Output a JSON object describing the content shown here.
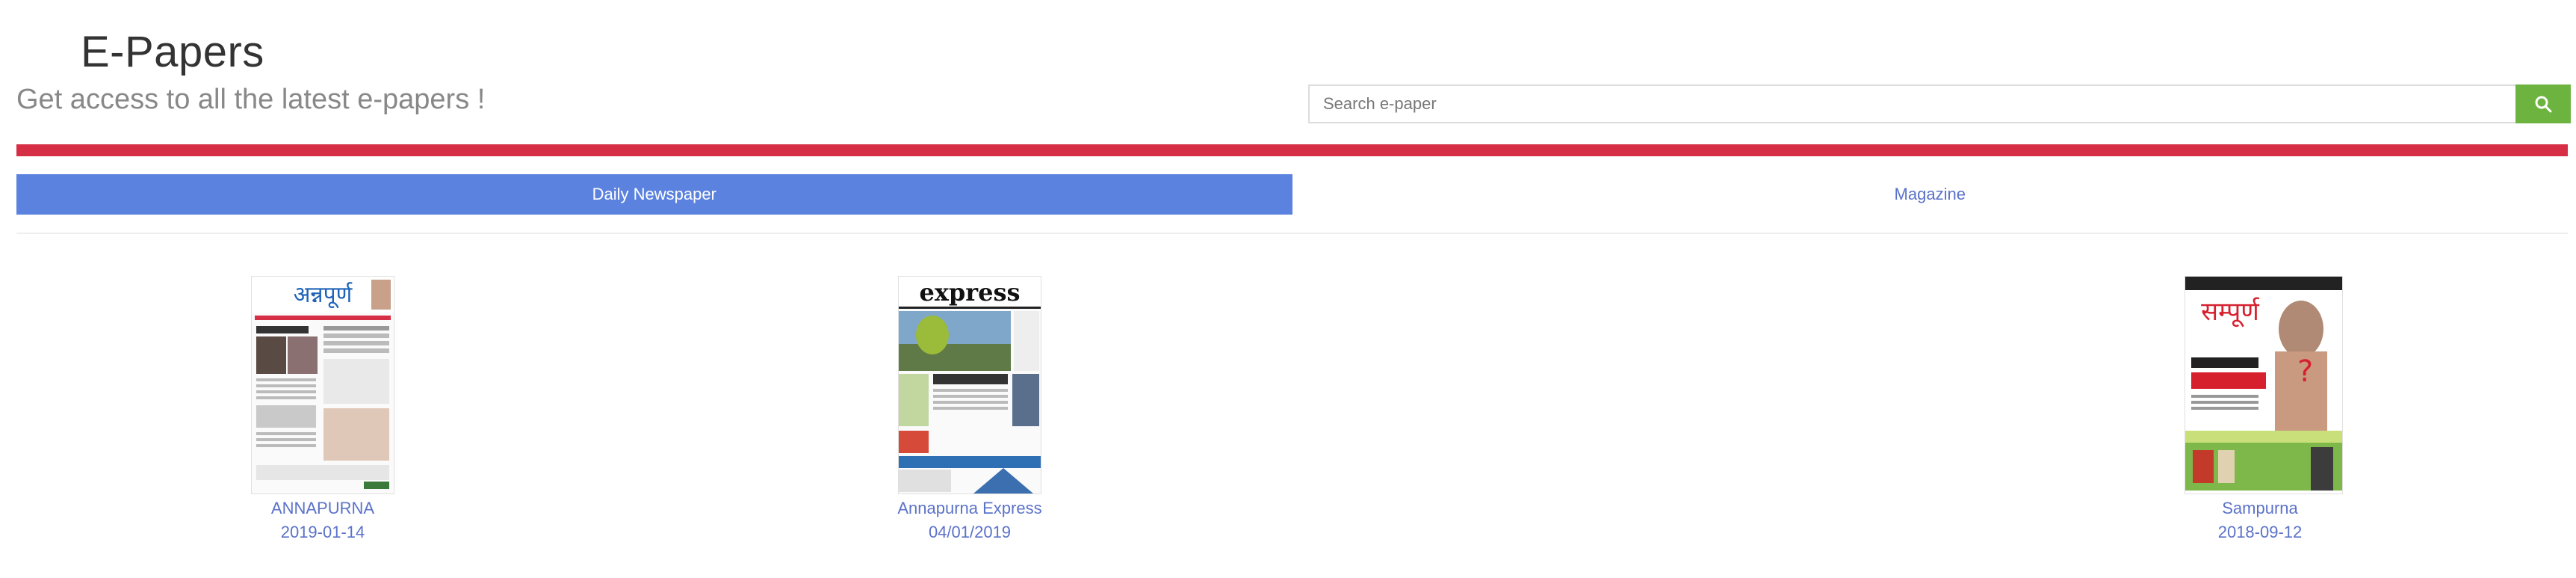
{
  "header": {
    "title": "E-Papers",
    "subtitle": "Get access to all the latest e-papers !"
  },
  "search": {
    "placeholder": "Search e-paper",
    "value": "",
    "button_color": "#6cb33f",
    "button_icon": "search-icon"
  },
  "accent_bar_color": "#d62e44",
  "tabs": [
    {
      "label": "Daily Newspaper",
      "active": true
    },
    {
      "label": "Magazine",
      "active": false
    }
  ],
  "papers": [
    {
      "name": "ANNAPURNA",
      "date": "2019-01-14",
      "masthead": "अन्नपूर्ण"
    },
    {
      "name": "Annapurna Express",
      "date": "04/01/2019",
      "masthead": "express"
    },
    {
      "name": "Sampurna",
      "date": "2018-09-12",
      "masthead": "सम्पूर्ण"
    }
  ]
}
